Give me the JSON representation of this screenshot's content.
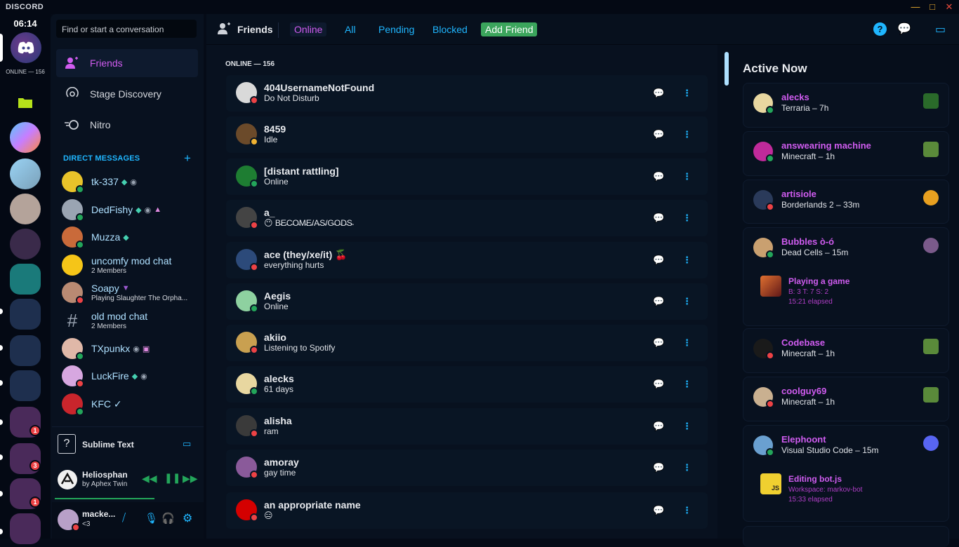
{
  "app": {
    "brand": "DISCORD",
    "clock": "06:14",
    "online_label": "ONLINE — 156"
  },
  "search": {
    "placeholder": "Find or start a conversation"
  },
  "nav": [
    {
      "label": "Friends"
    },
    {
      "label": "Stage Discovery"
    },
    {
      "label": "Nitro"
    }
  ],
  "dm_header": "DIRECT MESSAGES",
  "dms": [
    {
      "name": "tk-337",
      "sub": "",
      "status": "on",
      "color": "#e8c32a"
    },
    {
      "name": "DedFishy",
      "sub": "",
      "status": "on",
      "color": "#9aa4b2"
    },
    {
      "name": "Muzza",
      "sub": "",
      "status": "on",
      "color": "#c96a3a"
    },
    {
      "name": "uncomfy mod chat",
      "sub": "2 Members",
      "status": "",
      "color": "#f5c518"
    },
    {
      "name": "Soapy",
      "sub": "Playing Slaughter The Orpha...",
      "status": "dnd",
      "color": "#b98a73"
    },
    {
      "name": "old mod chat",
      "sub": "2 Members",
      "status": "",
      "color": ""
    },
    {
      "name": "TXpunkx",
      "sub": "",
      "status": "on",
      "color": "#e0b8a8"
    },
    {
      "name": "LuckFire",
      "sub": "",
      "status": "dnd",
      "color": "#d7a7e0"
    },
    {
      "name": "KFC ✓",
      "sub": "",
      "status": "on",
      "color": "#c9252c"
    }
  ],
  "activity": {
    "label": "Sublime Text"
  },
  "music": {
    "title": "Heliosphan",
    "artist": "by Aphex Twin"
  },
  "user": {
    "name": "macke...",
    "status": "<3"
  },
  "topbar": {
    "title": "Friends",
    "tabs": [
      "Online",
      "All",
      "Pending",
      "Blocked",
      "Add Friend"
    ]
  },
  "online_header": "ONLINE — 156",
  "friends": [
    {
      "name": "404UsernameNotFound",
      "status": "Do Not Disturb",
      "st": "dnd",
      "color": "#d9d9d9"
    },
    {
      "name": "8459",
      "status": "Idle",
      "st": "idle",
      "color": "#6b4a2a"
    },
    {
      "name": "[distant rattling]",
      "status": "Online",
      "st": "on",
      "color": "#1e7d32"
    },
    {
      "name": "a_",
      "status": "😶 B̵E̵C̵O̵M̵E̵/A̵S̵/G̵O̵D̵S̵",
      "st": "dnd",
      "color": "#444"
    },
    {
      "name": "ace (they/xe/it) 🍒",
      "status": "everything hurts",
      "st": "dnd",
      "color": "#2c4a7a"
    },
    {
      "name": "Aegis",
      "status": "Online",
      "st": "on",
      "color": "#8ed1a0"
    },
    {
      "name": "akiio",
      "status": "Listening to Spotify",
      "st": "dnd",
      "color": "#c9a050"
    },
    {
      "name": "alecks",
      "status": "61 days",
      "st": "on",
      "color": "#e8d7a0"
    },
    {
      "name": "alisha",
      "status": "ram",
      "st": "dnd",
      "color": "#3a3a3a"
    },
    {
      "name": "amoray",
      "status": "gay time",
      "st": "dnd",
      "color": "#8a5a9a"
    },
    {
      "name": "an appropriate name",
      "status": "😑",
      "st": "dnd",
      "color": "#d40000"
    }
  ],
  "active_now": {
    "title": "Active Now",
    "cards": [
      {
        "name": "alecks",
        "game": "Terraria – 7h",
        "st": "on",
        "color": "#e8d7a0",
        "icon_color": "#2a6a2a"
      },
      {
        "name": "answearing machine",
        "game": "Minecraft – 1h",
        "st": "on",
        "color": "#c02a9a",
        "icon_color": "#5a8a3a"
      },
      {
        "name": "artisiole",
        "game": "Borderlands 2 – 33m",
        "st": "dnd",
        "color": "#2a3a5a",
        "icon_color": "#e8a020"
      },
      {
        "name": "Bubbles ò-ó",
        "game": "Dead Cells – 15m",
        "st": "on",
        "color": "#c9a070",
        "icon_color": "#7a5a8a",
        "sub": {
          "title": "Playing a game",
          "line1": "B: 3 T: 7 S: 2",
          "line2": "15:21 elapsed"
        }
      },
      {
        "name": "Codebase",
        "game": "Minecraft – 1h",
        "st": "dnd",
        "color": "#1a1a1a",
        "icon_color": "#5a8a3a"
      },
      {
        "name": "coolguy69",
        "game": "Minecraft – 1h",
        "st": "dnd",
        "color": "#c9b090",
        "icon_color": "#5a8a3a"
      },
      {
        "name": "Elephoont",
        "game": "Visual Studio Code – 15m",
        "st": "on",
        "color": "#6aa0d0",
        "icon_color": "#5865f2",
        "sub": {
          "title": "Editing bot.js",
          "line1": "Workspace: markov-bot",
          "line2": "15:33 elapsed"
        }
      }
    ]
  },
  "colors": {
    "accent": "#d05cf0",
    "link": "#1fb6ff",
    "online": "#23a55a",
    "dnd": "#ed4245",
    "idle": "#f0b232"
  }
}
